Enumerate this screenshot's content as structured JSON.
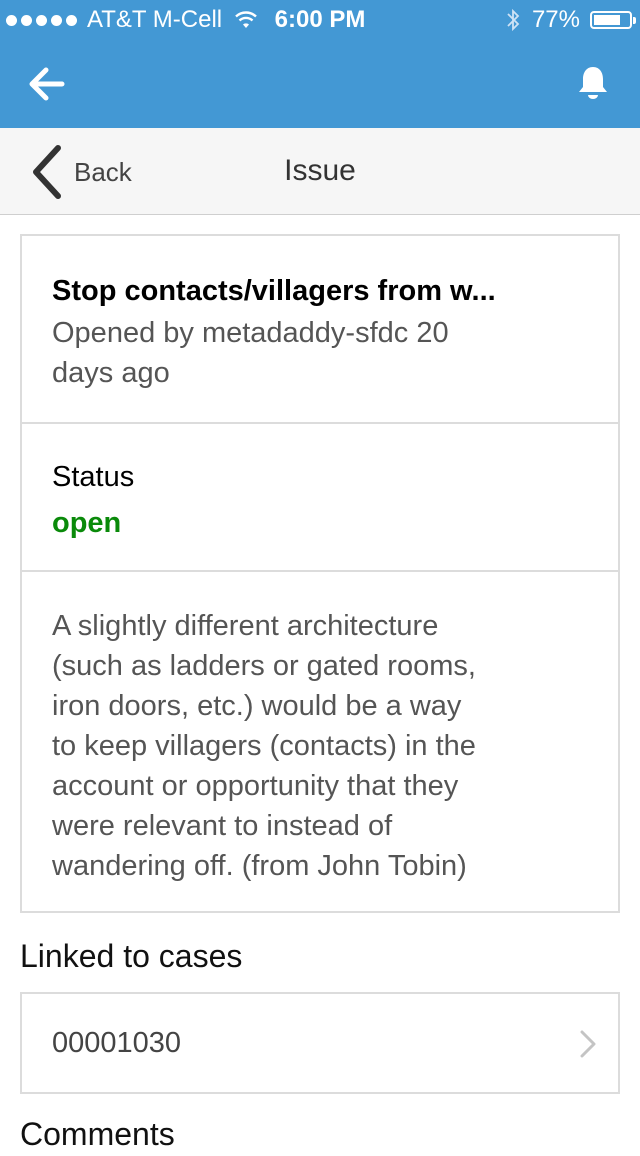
{
  "status_bar": {
    "carrier": "AT&T M-Cell",
    "time": "6:00 PM",
    "battery": "77%",
    "battery_level": 0.77
  },
  "header": {
    "back_icon": "arrow-left-icon",
    "notifications_icon": "bell-icon"
  },
  "navbar": {
    "back_label": "Back",
    "title": "Issue"
  },
  "issue": {
    "title": "Stop contacts/villagers from w...",
    "opened_line1": "Opened by metadaddy-sfdc 20",
    "opened_line2": "days ago",
    "status_label": "Status",
    "status_value": "open",
    "description_lines": [
      "A slightly different architecture",
      "(such as ladders or gated rooms,",
      "iron doors, etc.) would be a way",
      "to keep villagers (contacts) in the",
      "account or opportunity that they",
      "were relevant to instead of",
      "wandering off. (from John Tobin)"
    ]
  },
  "linked_cases": {
    "heading": "Linked to cases",
    "items": [
      {
        "number": "00001030"
      }
    ]
  },
  "comments": {
    "heading": "Comments"
  },
  "colors": {
    "header_blue": "#4398d4",
    "status_open_green": "#0a8a0a"
  }
}
